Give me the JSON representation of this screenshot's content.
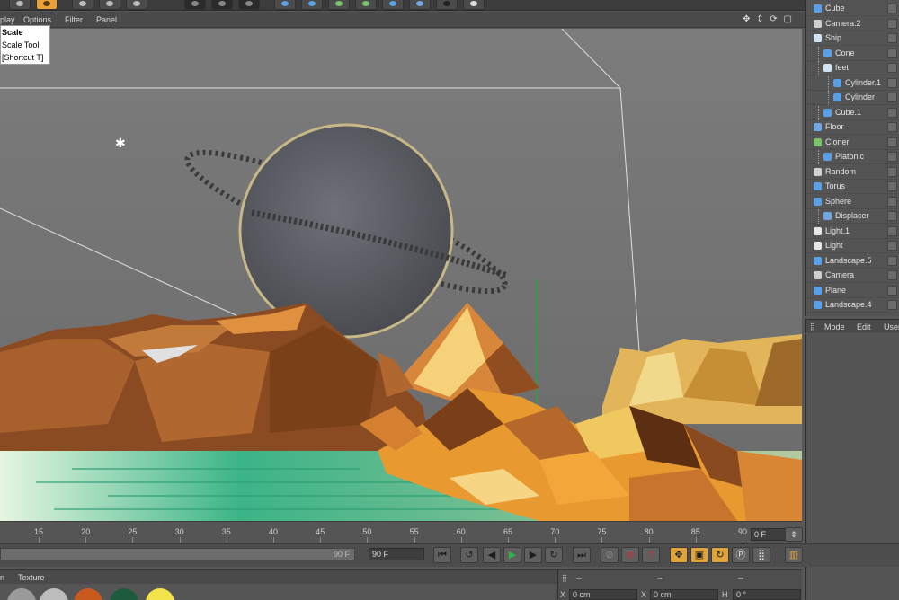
{
  "viewport_menu": {
    "items": [
      "play",
      "Options",
      "Filter",
      "Panel"
    ]
  },
  "tooltip": {
    "title": "Scale",
    "subtitle": "Scale Tool",
    "shortcut": "[Shortcut T]"
  },
  "objects": [
    {
      "label": "Cube",
      "icon": "cube-icon",
      "color": "#5aa0e6",
      "indent": 0
    },
    {
      "label": "Camera.2",
      "icon": "camera-icon",
      "color": "#cfcfcf",
      "indent": 0
    },
    {
      "label": "Ship",
      "icon": "null-icon",
      "color": "#cfe3f5",
      "indent": 0
    },
    {
      "label": "Cone",
      "icon": "cone-icon",
      "color": "#5aa0e6",
      "indent": 1
    },
    {
      "label": "feet",
      "icon": "null-icon",
      "color": "#cfe3f5",
      "indent": 1
    },
    {
      "label": "Cylinder.1",
      "icon": "cylinder-icon",
      "color": "#5aa0e6",
      "indent": 2
    },
    {
      "label": "Cylinder",
      "icon": "cylinder-icon",
      "color": "#5aa0e6",
      "indent": 2
    },
    {
      "label": "Cube.1",
      "icon": "cube-icon",
      "color": "#5aa0e6",
      "indent": 1
    },
    {
      "label": "Floor",
      "icon": "floor-icon",
      "color": "#6fa7e0",
      "indent": 0
    },
    {
      "label": "Cloner",
      "icon": "cloner-icon",
      "color": "#79c36b",
      "indent": 0
    },
    {
      "label": "Platonic",
      "icon": "platonic-icon",
      "color": "#5aa0e6",
      "indent": 1
    },
    {
      "label": "Random",
      "icon": "random-icon",
      "color": "#d0d0d0",
      "indent": 0
    },
    {
      "label": "Torus",
      "icon": "torus-icon",
      "color": "#5aa0e6",
      "indent": 0
    },
    {
      "label": "Sphere",
      "icon": "sphere-icon",
      "color": "#5aa0e6",
      "indent": 0
    },
    {
      "label": "Displacer",
      "icon": "displacer-icon",
      "color": "#6fa7e0",
      "indent": 1
    },
    {
      "label": "Light.1",
      "icon": "light-icon",
      "color": "#e8e8e8",
      "indent": 0
    },
    {
      "label": "Light",
      "icon": "light-icon",
      "color": "#e8e8e8",
      "indent": 0
    },
    {
      "label": "Landscape.5",
      "icon": "landscape-icon",
      "color": "#5aa0e6",
      "indent": 0
    },
    {
      "label": "Camera",
      "icon": "camera-icon",
      "color": "#cfcfcf",
      "indent": 0
    },
    {
      "label": "Plane",
      "icon": "plane-icon",
      "color": "#5aa0e6",
      "indent": 0
    },
    {
      "label": "Landscape.4",
      "icon": "landscape-icon",
      "color": "#5aa0e6",
      "indent": 0
    }
  ],
  "attributes_menu": {
    "items": [
      "Mode",
      "Edit",
      "User"
    ]
  },
  "timeline": {
    "ticks": [
      "15",
      "20",
      "25",
      "30",
      "35",
      "40",
      "45",
      "50",
      "55",
      "60",
      "65",
      "70",
      "75",
      "80",
      "85",
      "90"
    ],
    "current_frame": "0 F",
    "range_end": "90 F",
    "end_frame": "90 F"
  },
  "material_menu": {
    "items": [
      "n",
      "Texture"
    ]
  },
  "coordinates": {
    "header": [
      "--",
      "--",
      "--"
    ],
    "fields": [
      {
        "axis": "X",
        "value": "0 cm"
      },
      {
        "axis": "X",
        "value": "0 cm"
      },
      {
        "axis": "H",
        "value": "0 °"
      }
    ]
  },
  "colors": {
    "accent": "#e9a237",
    "play": "#2fb347",
    "record": "#cc3333"
  }
}
